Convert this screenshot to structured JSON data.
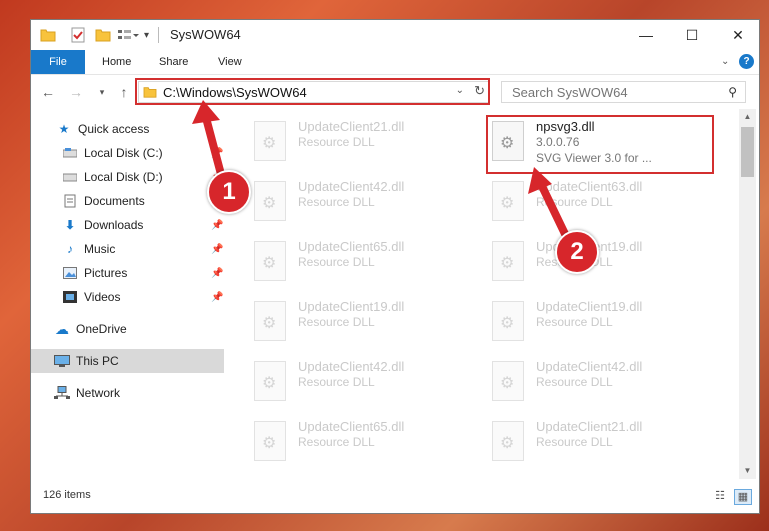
{
  "window": {
    "title": "SysWOW64",
    "controls": [
      "minimize-icon",
      "maximize-icon",
      "close-icon"
    ]
  },
  "quick_access_toolbar": [
    "folder-icon",
    "properties-icon",
    "new-folder-icon",
    "customize-icon"
  ],
  "ribbon": {
    "tabs": [
      {
        "label": "File",
        "active": true
      },
      {
        "label": "Home"
      },
      {
        "label": "Share"
      },
      {
        "label": "View"
      }
    ],
    "expand_icon": "chevron-down-icon",
    "help_icon": "help-icon"
  },
  "navigation": {
    "back_icon": "back-arrow-icon",
    "forward_icon": "forward-arrow-icon",
    "recent_icon": "chevron-down-icon",
    "up_icon": "up-arrow-icon",
    "address": "C:\\Windows\\SysWOW64",
    "search_placeholder": "Search SysWOW64"
  },
  "sidebar": {
    "items": [
      {
        "label": "Quick access",
        "icon": "star-icon",
        "pinned": false
      },
      {
        "label": "Local Disk (C:)",
        "icon": "drive-icon",
        "pinned": true
      },
      {
        "label": "Local Disk (D:)",
        "icon": "drive-icon",
        "pinned": true
      },
      {
        "label": "Documents",
        "icon": "documents-icon",
        "pinned": true
      },
      {
        "label": "Downloads",
        "icon": "downloads-icon",
        "pinned": true
      },
      {
        "label": "Music",
        "icon": "music-icon",
        "pinned": true
      },
      {
        "label": "Pictures",
        "icon": "pictures-icon",
        "pinned": true
      },
      {
        "label": "Videos",
        "icon": "videos-icon",
        "pinned": true
      },
      {
        "label": "OneDrive",
        "icon": "cloud-icon",
        "pinned": false
      },
      {
        "label": "This PC",
        "icon": "computer-icon",
        "pinned": false,
        "selected": true
      },
      {
        "label": "Network",
        "icon": "network-icon",
        "pinned": false
      }
    ]
  },
  "files": {
    "left_column": [
      {
        "name": "UpdateClient21.dll",
        "desc": "Resource DLL"
      },
      {
        "name": "UpdateClient42.dll",
        "desc": "Resource DLL"
      },
      {
        "name": "UpdateClient65.dll",
        "desc": "Resource DLL"
      },
      {
        "name": "UpdateClient19.dll",
        "desc": "Resource DLL"
      },
      {
        "name": "UpdateClient42.dll",
        "desc": "Resource DLL"
      },
      {
        "name": "UpdateClient65.dll",
        "desc": "Resource DLL"
      }
    ],
    "right_column": [
      {
        "name": "npsvg3.dll",
        "version": "3.0.0.76",
        "desc": "SVG Viewer 3.0 for ..."
      },
      {
        "name": "UpdateClient63.dll",
        "desc": "Resource DLL"
      },
      {
        "name": "UpdateClient19.dll",
        "desc": "Resource DLL"
      },
      {
        "name": "UpdateClient19.dll",
        "desc": "Resource DLL"
      },
      {
        "name": "UpdateClient42.dll",
        "desc": "Resource DLL"
      },
      {
        "name": "UpdateClient21.dll",
        "desc": "Resource DLL"
      }
    ]
  },
  "status": {
    "item_count": "126 items"
  },
  "annotations": {
    "step1": "1",
    "step2": "2",
    "highlight_color": "#d32f2f"
  }
}
